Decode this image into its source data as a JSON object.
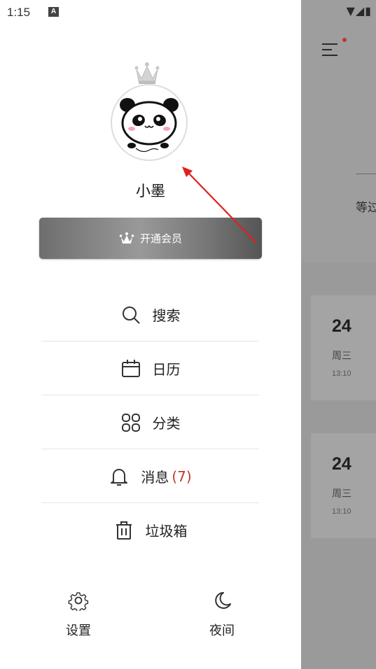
{
  "status_bar": {
    "time": "1:15",
    "indicator": "A",
    "right_icons": "▼◢▮"
  },
  "drawer": {
    "username": "小墨",
    "vip_button_label": "开通会员",
    "menu": [
      {
        "label": "搜索",
        "icon": "search-icon"
      },
      {
        "label": "日历",
        "icon": "calendar-icon"
      },
      {
        "label": "分类",
        "icon": "category-icon"
      },
      {
        "label": "消息",
        "count": "(7)",
        "icon": "bell-icon"
      },
      {
        "label": "垃圾箱",
        "icon": "trash-icon"
      }
    ],
    "bottom": {
      "settings_label": "设置",
      "night_label": "夜间"
    }
  },
  "background": {
    "partial_text": "等过",
    "cards": [
      {
        "day": "24",
        "weekday": "周三",
        "time": "13:10"
      },
      {
        "day": "24",
        "weekday": "周三",
        "time": "13:10"
      }
    ]
  },
  "colors": {
    "accent_red": "#c0392b",
    "overlay_gray": "#9c9c9c"
  }
}
